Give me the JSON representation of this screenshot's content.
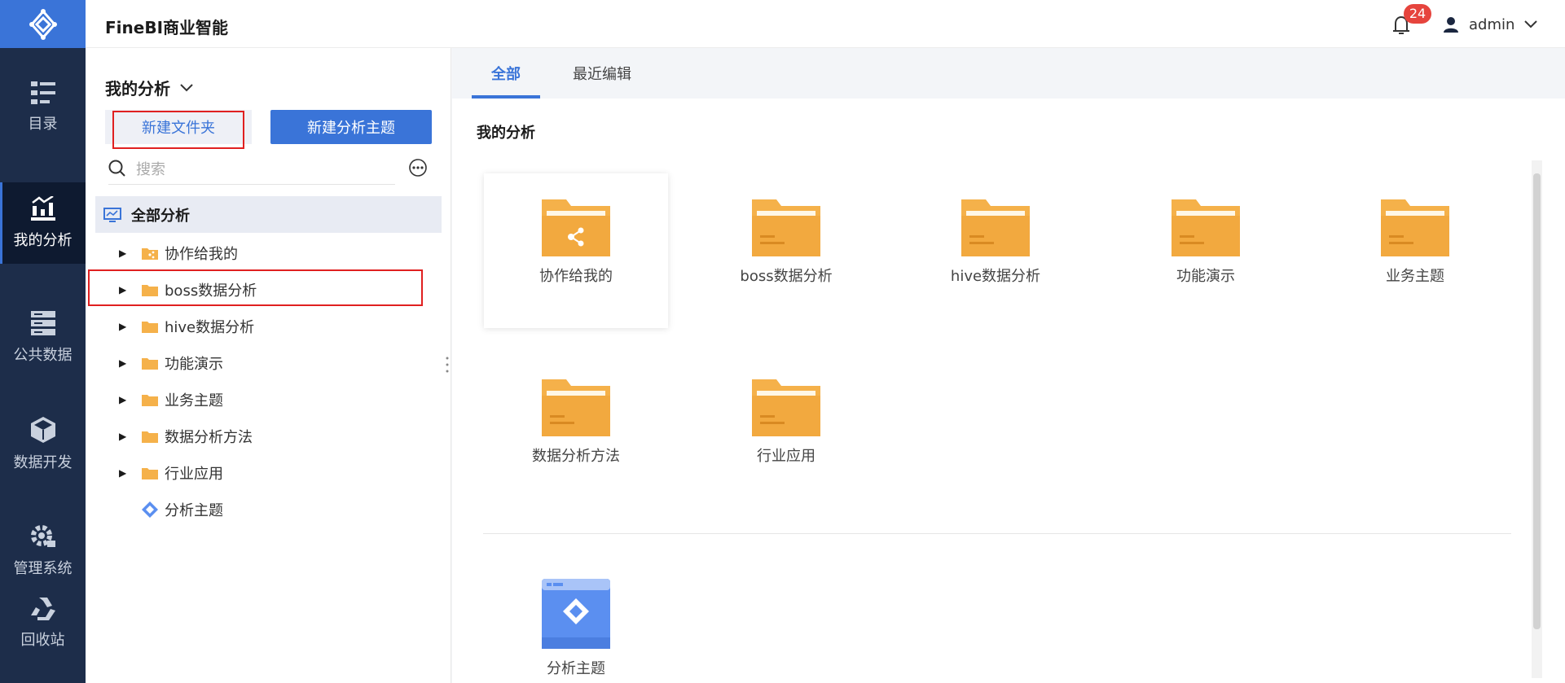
{
  "header": {
    "app_title": "FineBI商业智能",
    "notification_count": "24",
    "username": "admin"
  },
  "left_nav": {
    "items": [
      {
        "label": "目录",
        "icon": "catalog-icon"
      },
      {
        "label": "我的分析",
        "icon": "my-analysis-icon",
        "active": true
      },
      {
        "label": "公共数据",
        "icon": "public-data-icon"
      },
      {
        "label": "数据开发",
        "icon": "data-dev-icon"
      },
      {
        "label": "管理系统",
        "icon": "gear-icon"
      },
      {
        "label": "回收站",
        "icon": "recycle-icon"
      }
    ]
  },
  "middle": {
    "title": "我的分析",
    "new_folder_label": "新建文件夹",
    "new_subject_label": "新建分析主题",
    "search_placeholder": "搜索",
    "tree_root": "全部分析",
    "tree_items": [
      {
        "label": "协作给我的",
        "icon": "shared-folder-icon",
        "expandable": true
      },
      {
        "label": "boss数据分析",
        "icon": "folder-icon",
        "expandable": true
      },
      {
        "label": "hive数据分析",
        "icon": "folder-icon",
        "expandable": true
      },
      {
        "label": "功能演示",
        "icon": "folder-icon",
        "expandable": true
      },
      {
        "label": "业务主题",
        "icon": "folder-icon",
        "expandable": true
      },
      {
        "label": "数据分析方法",
        "icon": "folder-icon",
        "expandable": true
      },
      {
        "label": "行业应用",
        "icon": "folder-icon",
        "expandable": true
      },
      {
        "label": "分析主题",
        "icon": "analysis-subject-icon",
        "expandable": false
      }
    ]
  },
  "right": {
    "tabs": [
      {
        "label": "全部",
        "active": true
      },
      {
        "label": "最近编辑",
        "active": false
      }
    ],
    "section_title": "我的分析",
    "folders": [
      {
        "label": "协作给我的",
        "type": "shared"
      },
      {
        "label": "boss数据分析",
        "type": "folder"
      },
      {
        "label": "hive数据分析",
        "type": "folder"
      },
      {
        "label": "功能演示",
        "type": "folder"
      },
      {
        "label": "业务主题",
        "type": "folder"
      },
      {
        "label": "数据分析方法",
        "type": "folder"
      },
      {
        "label": "行业应用",
        "type": "folder"
      }
    ],
    "subjects": [
      {
        "label": "分析主题"
      }
    ]
  },
  "colors": {
    "accent": "#3a74d8",
    "nav_bg": "#1d2d4a",
    "folder": "#f5b14a",
    "highlight": "#e02020"
  }
}
